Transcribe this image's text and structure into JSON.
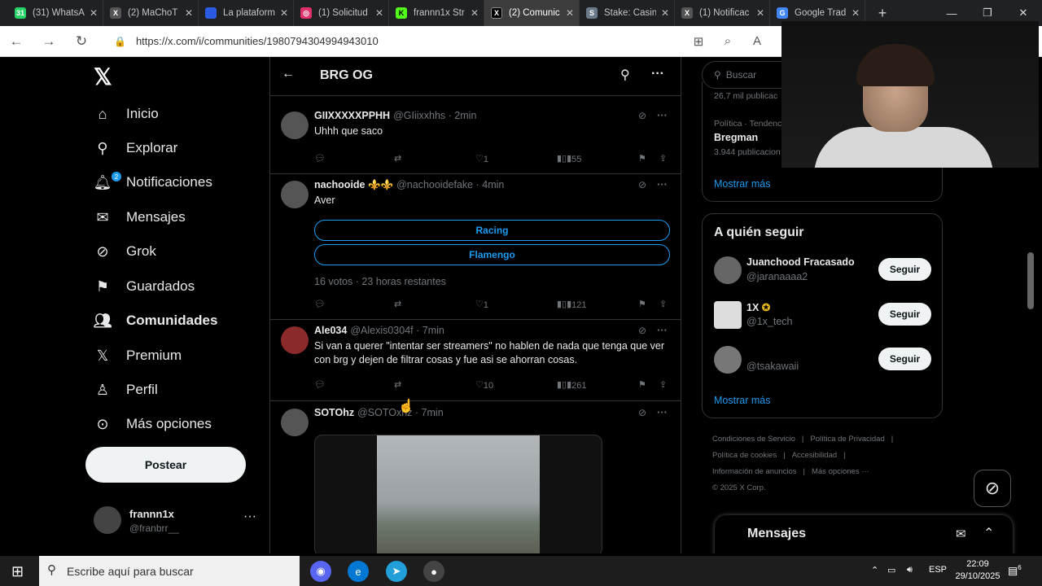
{
  "browser": {
    "tabs": [
      {
        "title": "(31) WhatsA",
        "icon": "whatsapp-icon",
        "color": "#25d366"
      },
      {
        "title": "(2) MaChoT",
        "icon": "x-icon",
        "color": "#333333"
      },
      {
        "title": "La plataform",
        "icon": "flag-icon",
        "color": "#2b5be0"
      },
      {
        "title": "(1) Solicitud",
        "icon": "instagram-icon",
        "color": "#e1306c"
      },
      {
        "title": "frannn1x Str",
        "icon": "kick-icon",
        "color": "#53fc18"
      },
      {
        "title": "(2) Comunic",
        "icon": "x-icon",
        "color": "#000000"
      },
      {
        "title": "Stake: Casin",
        "icon": "stake-icon",
        "color": "#6b7a8a"
      },
      {
        "title": "(1) Notificac",
        "icon": "x-icon",
        "color": "#333333"
      },
      {
        "title": "Google Trad",
        "icon": "translate-icon",
        "color": "#4285f4"
      }
    ],
    "url": "https://x.com/i/communities/1980794304994943010"
  },
  "nav": {
    "items": [
      {
        "label": "Inicio",
        "icon": "home-icon"
      },
      {
        "label": "Explorar",
        "icon": "search-icon"
      },
      {
        "label": "Notificaciones",
        "icon": "bell-icon",
        "badge": "2"
      },
      {
        "label": "Mensajes",
        "icon": "mail-icon"
      },
      {
        "label": "Grok",
        "icon": "grok-icon"
      },
      {
        "label": "Guardados",
        "icon": "bookmark-icon"
      },
      {
        "label": "Comunidades",
        "icon": "communities-icon"
      },
      {
        "label": "Premium",
        "icon": "x-logo-icon"
      },
      {
        "label": "Perfil",
        "icon": "person-icon"
      },
      {
        "label": "Más opciones",
        "icon": "more-circle-icon"
      }
    ],
    "post_label": "Postear",
    "account": {
      "name": "frannn1x",
      "handle": "@franbrr__"
    }
  },
  "feed": {
    "title": "BRG OG",
    "tweets": [
      {
        "name": "GIIXXXXXPPHH",
        "handle": "@GIiixxhhs",
        "time": "· 2min",
        "text": "Uhhh que saco",
        "likes": "1",
        "views": "55"
      },
      {
        "name": "nachooide ⚜️⚜️",
        "handle": "@nachooidefake",
        "time": "· 4min",
        "text": "Aver",
        "poll_options": [
          "Racing",
          "Flamengo"
        ],
        "poll_info": "16 votos · 23 horas restantes",
        "likes": "1",
        "views": "121"
      },
      {
        "name": "Ale034",
        "handle": "@Alexis0304f",
        "time": "· 7min",
        "text": "Si van a querer \"intentar ser streamers\" no hablen de nada que tenga que ver con brg y dejen de filtrar cosas y fue asi se ahorran cosas.",
        "likes": "10",
        "views": "261"
      },
      {
        "name": "SOTOhz",
        "handle": "@SOTOxhz",
        "time": "· 7min"
      }
    ]
  },
  "sidebar": {
    "search_placeholder": "Buscar",
    "trend_top_count": "26,7 mil publicac",
    "trend_category": "Política · Tendenc",
    "trend_name": "Bregman",
    "trend_count": "3.944 publicacion",
    "show_more": "Mostrar más",
    "who_to_follow_title": "A quién seguir",
    "follow": [
      {
        "name": "Juanchood Fracasado",
        "handle": "@jaranaaaa2"
      },
      {
        "name": "1X",
        "handle": "@1x_tech"
      },
      {
        "name": "",
        "handle": "@tsakawaii"
      }
    ],
    "follow_label": "Seguir",
    "footer": {
      "terms": "Condiciones de Servicio",
      "privacy": "Política de Privacidad",
      "cookies": "Política de cookies",
      "accessibility": "Accesibilidad",
      "ads": "Información de anuncios",
      "more": "Más opciones ···",
      "copyright": "© 2025 X Corp."
    },
    "messages_title": "Mensajes"
  },
  "taskbar": {
    "search_placeholder": "Escribe aquí para buscar",
    "lang": "ESP",
    "time": "22:09",
    "date": "29/10/2025",
    "notif_count": "6"
  },
  "colors": {
    "accent": "#1d9bf0",
    "background": "#000000",
    "text": "#e7e9ea",
    "muted": "#71767b"
  }
}
